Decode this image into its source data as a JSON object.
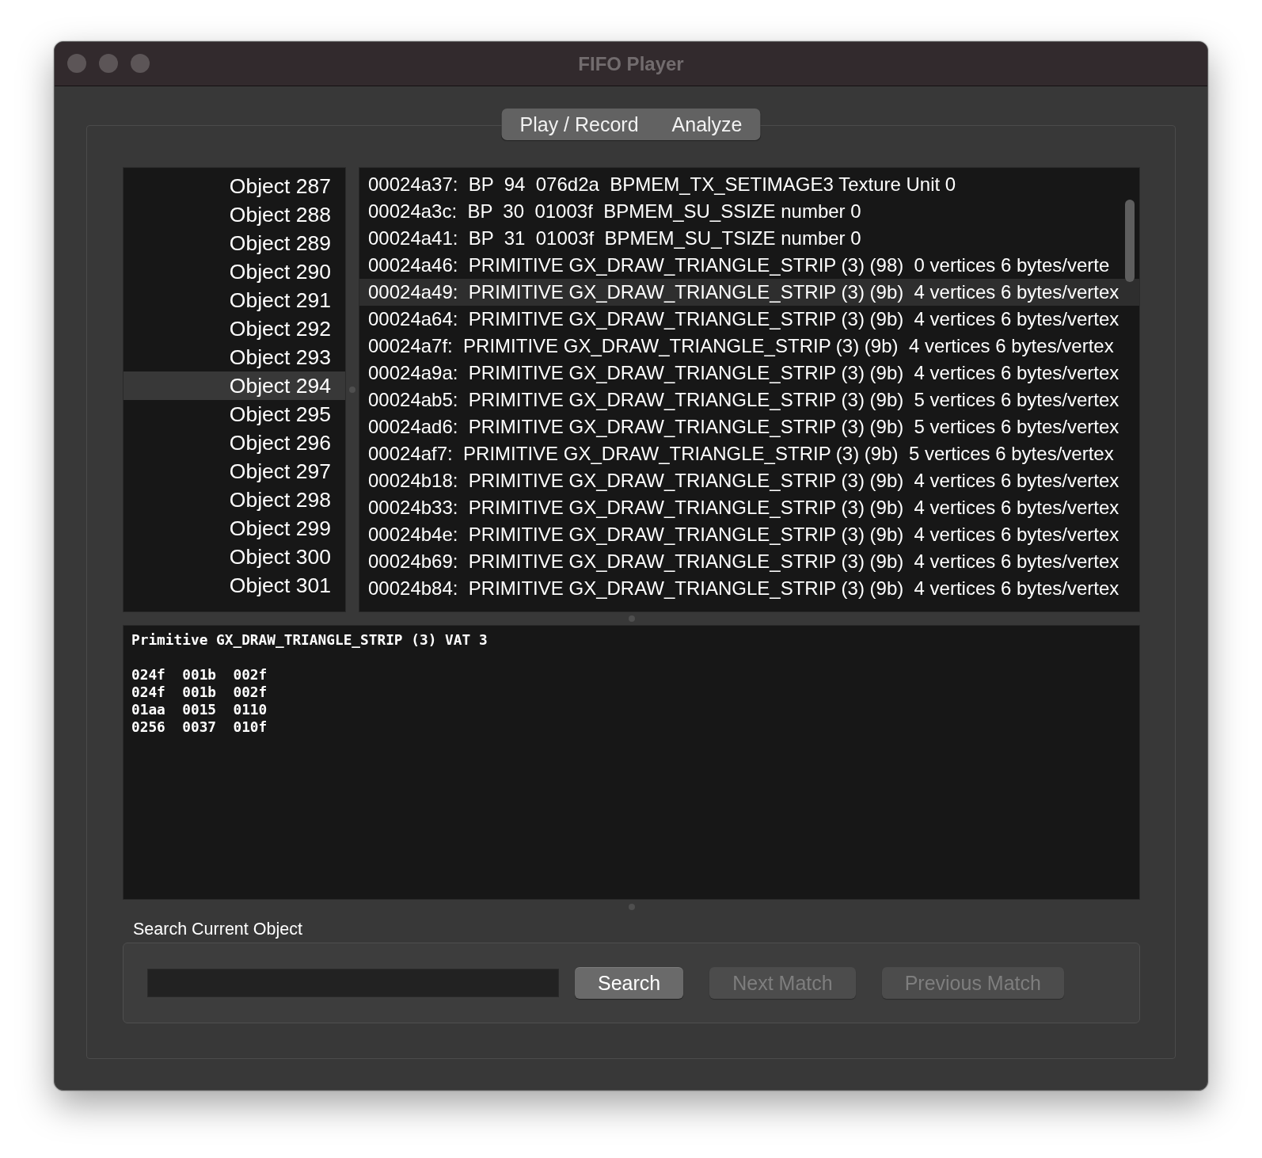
{
  "window": {
    "title": "FIFO Player"
  },
  "tabs": [
    {
      "label": "Play / Record"
    },
    {
      "label": "Analyze"
    }
  ],
  "objects": [
    {
      "label": "Object 287",
      "selected": false
    },
    {
      "label": "Object 288",
      "selected": false
    },
    {
      "label": "Object 289",
      "selected": false
    },
    {
      "label": "Object 290",
      "selected": false
    },
    {
      "label": "Object 291",
      "selected": false
    },
    {
      "label": "Object 292",
      "selected": false
    },
    {
      "label": "Object 293",
      "selected": false
    },
    {
      "label": "Object 294",
      "selected": true
    },
    {
      "label": "Object 295",
      "selected": false
    },
    {
      "label": "Object 296",
      "selected": false
    },
    {
      "label": "Object 297",
      "selected": false
    },
    {
      "label": "Object 298",
      "selected": false
    },
    {
      "label": "Object 299",
      "selected": false
    },
    {
      "label": "Object 300",
      "selected": false
    },
    {
      "label": "Object 301",
      "selected": false
    }
  ],
  "commands": [
    {
      "text": "00024a37:  BP  94  076d2a  BPMEM_TX_SETIMAGE3 Texture Unit 0",
      "selected": false
    },
    {
      "text": "00024a3c:  BP  30  01003f  BPMEM_SU_SSIZE number 0",
      "selected": false
    },
    {
      "text": "00024a41:  BP  31  01003f  BPMEM_SU_TSIZE number 0",
      "selected": false
    },
    {
      "text": "00024a46:  PRIMITIVE GX_DRAW_TRIANGLE_STRIP (3) (98)  0 vertices 6 bytes/verte",
      "selected": false
    },
    {
      "text": "00024a49:  PRIMITIVE GX_DRAW_TRIANGLE_STRIP (3) (9b)  4 vertices 6 bytes/vertex",
      "selected": true
    },
    {
      "text": "00024a64:  PRIMITIVE GX_DRAW_TRIANGLE_STRIP (3) (9b)  4 vertices 6 bytes/vertex",
      "selected": false
    },
    {
      "text": "00024a7f:  PRIMITIVE GX_DRAW_TRIANGLE_STRIP (3) (9b)  4 vertices 6 bytes/vertex",
      "selected": false
    },
    {
      "text": "00024a9a:  PRIMITIVE GX_DRAW_TRIANGLE_STRIP (3) (9b)  4 vertices 6 bytes/vertex",
      "selected": false
    },
    {
      "text": "00024ab5:  PRIMITIVE GX_DRAW_TRIANGLE_STRIP (3) (9b)  5 vertices 6 bytes/vertex",
      "selected": false
    },
    {
      "text": "00024ad6:  PRIMITIVE GX_DRAW_TRIANGLE_STRIP (3) (9b)  5 vertices 6 bytes/vertex",
      "selected": false
    },
    {
      "text": "00024af7:  PRIMITIVE GX_DRAW_TRIANGLE_STRIP (3) (9b)  5 vertices 6 bytes/vertex",
      "selected": false
    },
    {
      "text": "00024b18:  PRIMITIVE GX_DRAW_TRIANGLE_STRIP (3) (9b)  4 vertices 6 bytes/vertex",
      "selected": false
    },
    {
      "text": "00024b33:  PRIMITIVE GX_DRAW_TRIANGLE_STRIP (3) (9b)  4 vertices 6 bytes/vertex",
      "selected": false
    },
    {
      "text": "00024b4e:  PRIMITIVE GX_DRAW_TRIANGLE_STRIP (3) (9b)  4 vertices 6 bytes/vertex",
      "selected": false
    },
    {
      "text": "00024b69:  PRIMITIVE GX_DRAW_TRIANGLE_STRIP (3) (9b)  4 vertices 6 bytes/vertex",
      "selected": false
    },
    {
      "text": "00024b84:  PRIMITIVE GX_DRAW_TRIANGLE_STRIP (3) (9b)  4 vertices 6 bytes/vertex",
      "selected": false
    }
  ],
  "detail": {
    "header": "Primitive GX_DRAW_TRIANGLE_STRIP (3) VAT 3",
    "rows": [
      "024f  001b  002f",
      "024f  001b  002f",
      "01aa  0015  0110",
      "0256  0037  010f"
    ]
  },
  "search": {
    "label": "Search Current Object",
    "buttons": [
      {
        "label": "Search",
        "disabled": false
      },
      {
        "label": "Next Match",
        "disabled": true
      },
      {
        "label": "Previous Match",
        "disabled": true
      }
    ]
  }
}
